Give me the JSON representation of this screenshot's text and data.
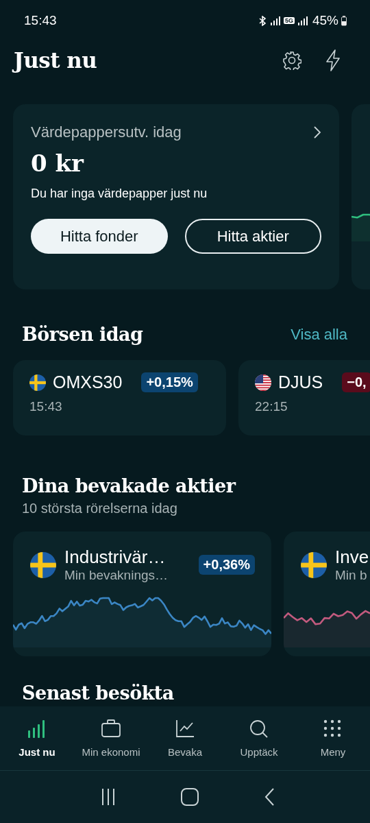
{
  "status_bar": {
    "time": "15:43",
    "network": "5G",
    "battery": "45%"
  },
  "header": {
    "title": "Just nu"
  },
  "summary_cards": [
    {
      "kind": "summary",
      "title": "Värdepappersutv. idag",
      "amount": "0 kr",
      "message": "Du har inga värdepapper just nu",
      "buttons": [
        {
          "label": "Hitta fonder",
          "kind": "filled"
        },
        {
          "label": "Hitta aktier",
          "kind": "outline"
        }
      ]
    },
    {
      "kind": "chart"
    }
  ],
  "market": {
    "title": "Börsen idag",
    "link": "Visa alla",
    "indices": [
      {
        "kind": "se",
        "name": "OMXS30",
        "change": "+0,15%",
        "color": "#0c4470",
        "time": "15:43"
      },
      {
        "kind": "us",
        "name": "DJUS",
        "change": "−0,",
        "color": "#5a0b1c",
        "time": "22:15"
      }
    ]
  },
  "watchlist": {
    "title": "Dina bevakade aktier",
    "subtitle": "10 största rörelserna idag",
    "stocks": [
      {
        "kind": "se",
        "name": "Industrivär…",
        "list": "Min bevaknings…",
        "change": "+0,36%",
        "color": "#3b86c4"
      },
      {
        "kind": "se",
        "name": "Inve",
        "list": "Min b",
        "color": "#c25a7e"
      }
    ]
  },
  "next_section": {
    "title": "Senast besökta"
  },
  "bottom_nav": [
    {
      "label": "Just nu",
      "selected": true
    },
    {
      "label": "Min ekonomi",
      "selected": false
    },
    {
      "label": "Bevaka",
      "selected": false
    },
    {
      "label": "Upptäck",
      "selected": false
    },
    {
      "label": "Meny",
      "selected": false
    }
  ]
}
